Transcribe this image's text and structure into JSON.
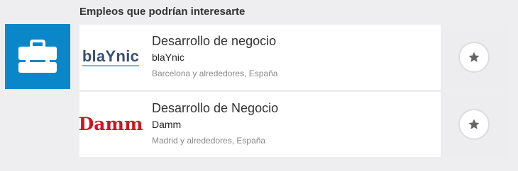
{
  "section": {
    "title": "Empleos que podrían interesarte"
  },
  "section_icon": "briefcase-icon",
  "colors": {
    "accent": "#0a87c8",
    "damm_red": "#d4121f",
    "blaynic_navy": "#3a4f73",
    "blaynic_blue": "#7ab7e0"
  },
  "jobs": [
    {
      "title": "Desarrollo de negocio",
      "company": "blaYnic",
      "location": "Barcelona y alrededores, España",
      "logo_text": "blaYnic",
      "save_icon": "star-icon"
    },
    {
      "title": "Desarrollo de Negocio",
      "company": "Damm",
      "location": "Madrid y alrededores, España",
      "logo_text": "Damm",
      "save_icon": "star-icon"
    }
  ]
}
